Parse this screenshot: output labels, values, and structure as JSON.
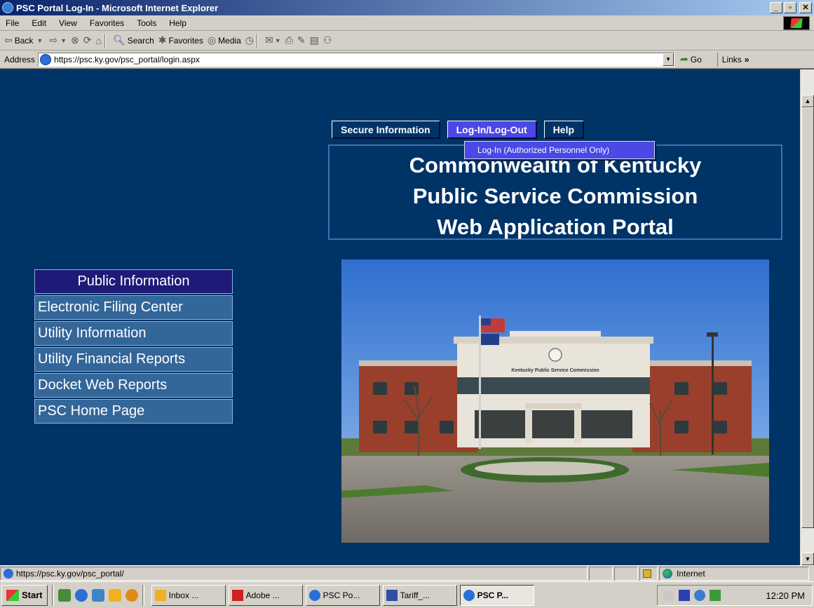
{
  "window": {
    "title": "PSC Portal Log-In - Microsoft Internet Explorer"
  },
  "menu": [
    "File",
    "Edit",
    "View",
    "Favorites",
    "Tools",
    "Help"
  ],
  "toolbar": {
    "back": "Back",
    "search": "Search",
    "favorites": "Favorites",
    "media": "Media"
  },
  "address": {
    "label": "Address",
    "url": "https://psc.ky.gov/psc_portal/login.aspx",
    "go": "Go",
    "links": "Links"
  },
  "page": {
    "nav": [
      "Secure Information",
      "Log-In/Log-Out",
      "Help"
    ],
    "dropdown_item": "Log-In (Authorized Personnel Only)",
    "header_lines": [
      "Commonwealth of Kentucky",
      "Public Service Commission",
      "Web Application Portal"
    ],
    "side_header": "Public Information",
    "side_items": [
      "Electronic Filing Center",
      "Utility Information",
      "Utility Financial Reports",
      "Docket Web Reports",
      "PSC Home Page"
    ],
    "building_sign": "Kentucky Public Service Commission"
  },
  "status": {
    "url": "https://psc.ky.gov/psc_portal/",
    "zone": "Internet"
  },
  "taskbar": {
    "start": "Start",
    "tasks": [
      "Inbox ...",
      "Adobe ...",
      "PSC Po...",
      "Tariff_...",
      "PSC P..."
    ],
    "clock": "12:20 PM"
  },
  "colors": {
    "page_bg": "#003366",
    "active_tab": "#4a48e6",
    "side_header_bg": "#1e1a78",
    "side_item_bg": "#336699"
  }
}
